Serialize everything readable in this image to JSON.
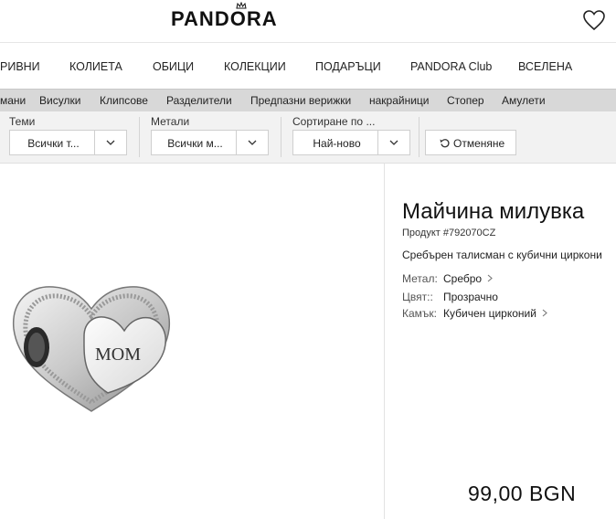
{
  "header": {
    "logo": "PANDORA"
  },
  "main_nav": [
    "РИВНИ",
    "КОЛИЕТА",
    "ОБИЦИ",
    "КОЛЕКЦИИ",
    "ПОДАРЪЦИ",
    "PANDORA Club",
    "ВСЕЛЕНА"
  ],
  "sub_nav": [
    "мани",
    "Висулки",
    "Клипсове",
    "Разделители",
    "Предпазни верижки",
    "накрайници",
    "Стопер",
    "Амулети"
  ],
  "filters": {
    "themes": {
      "label": "Теми",
      "value": "Всички т..."
    },
    "metals": {
      "label": "Метали",
      "value": "Всички м..."
    },
    "sort": {
      "label": "Сортиране по ...",
      "value": "Най-ново"
    },
    "reset_label": "Отменяне"
  },
  "product": {
    "title": "Майчина милувка",
    "code": "Продукт #792070CZ",
    "description": "Сребърен талисман с кубични циркони",
    "attributes": [
      {
        "key": "Метал:",
        "value": "Сребро"
      },
      {
        "key": "Цвят::",
        "value": "Прозрачно"
      },
      {
        "key": "Камък:",
        "value": "Кубичен цирконий"
      }
    ],
    "charm_text": "MOM",
    "price": "99,00 BGN"
  },
  "icons": {
    "wishlist": "heart-icon",
    "reset": "refresh-icon",
    "dropdown": "chevron-down-icon",
    "link": "chevron-right-icon"
  }
}
